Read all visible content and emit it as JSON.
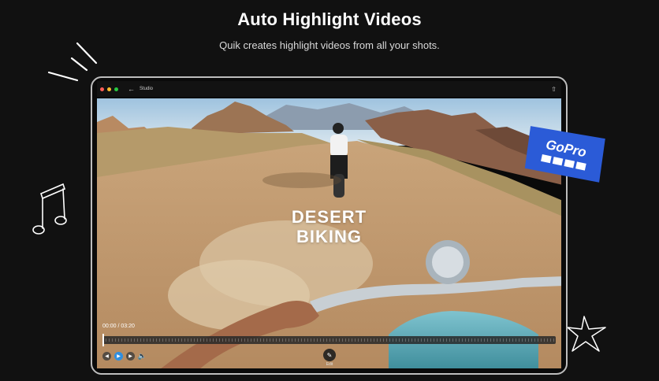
{
  "header": {
    "title": "Auto Highlight Videos",
    "subtitle": "Quik creates highlight videos from all your shots."
  },
  "app": {
    "title": "Studio",
    "back_icon": "arrow-left-icon",
    "share_icon": "share-icon",
    "window_dots": [
      "#ff5f57",
      "#febc2e",
      "#28c840"
    ]
  },
  "video": {
    "overlay_line1": "DESERT",
    "overlay_line2": "BIKING",
    "timecode": "00:00 / 03:20",
    "progress": 0,
    "edit_label": "Edit"
  },
  "controls": {
    "prev_icon": "skip-back-icon",
    "play_icon": "play-icon",
    "next_icon": "skip-forward-icon",
    "volume_icon": "volume-icon"
  },
  "badge": {
    "brand": "GoPro",
    "color": "#2b5bd7"
  },
  "colors": {
    "background": "#111111",
    "play_accent": "#2f8fe0"
  }
}
